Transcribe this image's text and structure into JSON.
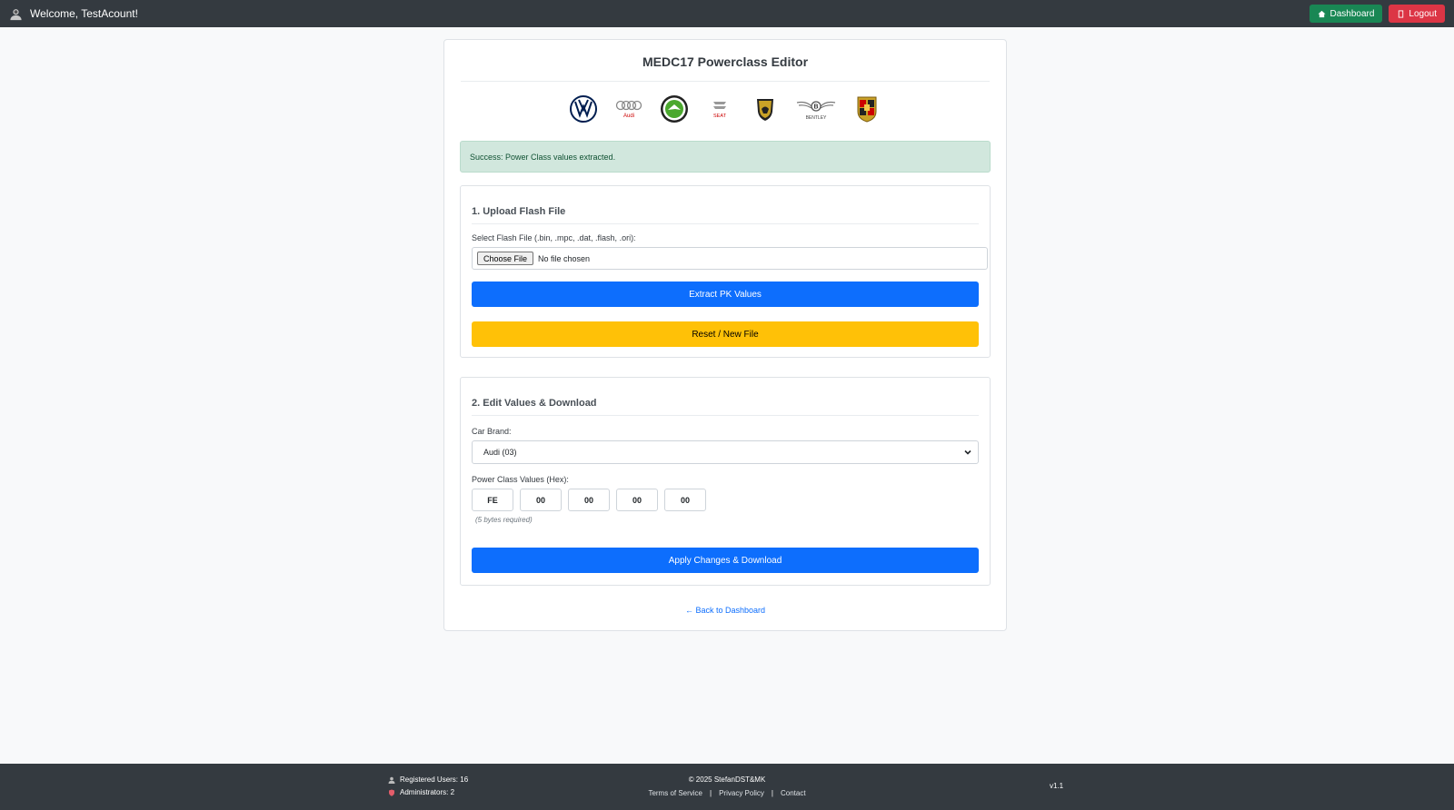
{
  "topbar": {
    "welcome": "Welcome, TestAcount!",
    "dashboard_label": "Dashboard",
    "logout_label": "Logout",
    "colors": {
      "bar": "#343a40",
      "dashboard": "#198754",
      "logout": "#dc3545"
    }
  },
  "card": {
    "title": "MEDC17 Powerclass Editor",
    "logos": [
      "volkswagen-logo",
      "audi-logo",
      "skoda-logo",
      "seat-logo",
      "lamborghini-logo",
      "bentley-logo",
      "porsche-logo"
    ],
    "logo_texts": {
      "audi": "Audi",
      "seat": "SEAT",
      "bentley": "BENTLEY"
    },
    "alert": "Success: Power Class values extracted.",
    "upload": {
      "title": "1. Upload Flash File",
      "file_label": "Select Flash File (.bin, .mpc, .dat, .flash, .ori):",
      "choose_label": "Choose File",
      "no_file": "No file chosen",
      "extract_label": "Extract PK Values",
      "reset_label": "Reset / New File"
    },
    "edit": {
      "title": "2. Edit Values & Download",
      "brand_label": "Car Brand:",
      "brand_value": "Audi (03)",
      "pk_label": "Power Class Values (Hex):",
      "hex_values": [
        "FE",
        "00",
        "00",
        "00",
        "00"
      ],
      "hint": "(5 bytes required)",
      "apply_label": "Apply Changes & Download"
    },
    "back_link": "← Back to Dashboard"
  },
  "footer": {
    "registered": "Registered Users: 16",
    "admins": "Administrators: 2",
    "copyright": "© 2025 StefanDST&MK",
    "links": [
      "Terms of Service",
      "Privacy Policy",
      "Contact"
    ],
    "version": "v1.1"
  }
}
